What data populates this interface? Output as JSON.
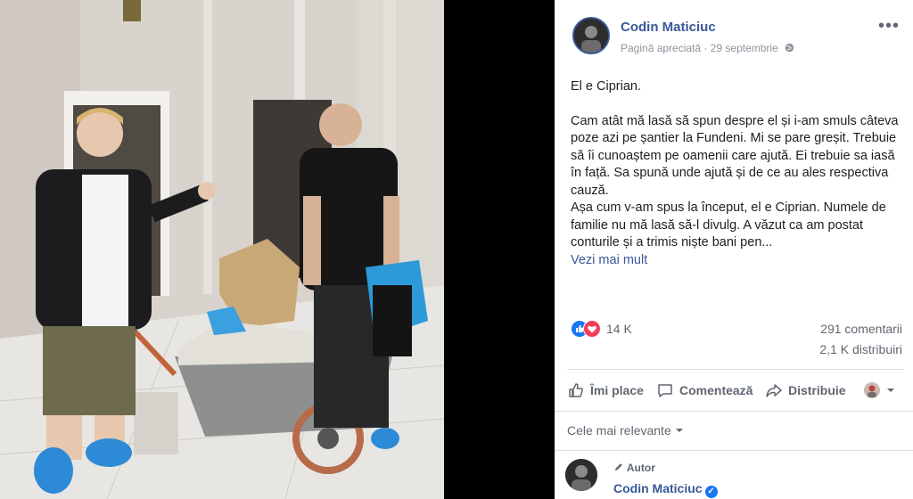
{
  "post": {
    "author": "Codin Maticiuc",
    "meta": "Pagină apreciată · 29 septembrie",
    "more_label": "•••",
    "paragraphs": [
      "El e Ciprian.",
      "Cam atât mă lasă să spun despre el și i-am smuls câteva poze azi pe șantier la Fundeni. Mi se pare greșit. Trebuie să îi cunoaștem pe oamenii care ajută. Ei trebuie sa iasă în față. Sa spună unde ajută și de ce au ales respectiva cauză.",
      "Așa cum v-am spus la început, el e Ciprian. Numele de familie nu mă lasă să-l divulg. A văzut ca am postat conturile și a trimis niște bani pen..."
    ],
    "see_more": "Vezi mai mult"
  },
  "stats": {
    "reactions_count": "14 K",
    "comments": "291 comentarii",
    "shares": "2,1 K distribuiri"
  },
  "actions": {
    "like": "Îmi place",
    "comment": "Comentează",
    "share": "Distribuie"
  },
  "comments_section": {
    "sort_label": "Cele mai relevante",
    "first_comment": {
      "badge": "Autor",
      "name": "Codin Maticiuc"
    }
  },
  "colors": {
    "link": "#385898",
    "like_blue": "#1877f2",
    "love_red": "#f33e58",
    "secondary_text": "#606770"
  }
}
